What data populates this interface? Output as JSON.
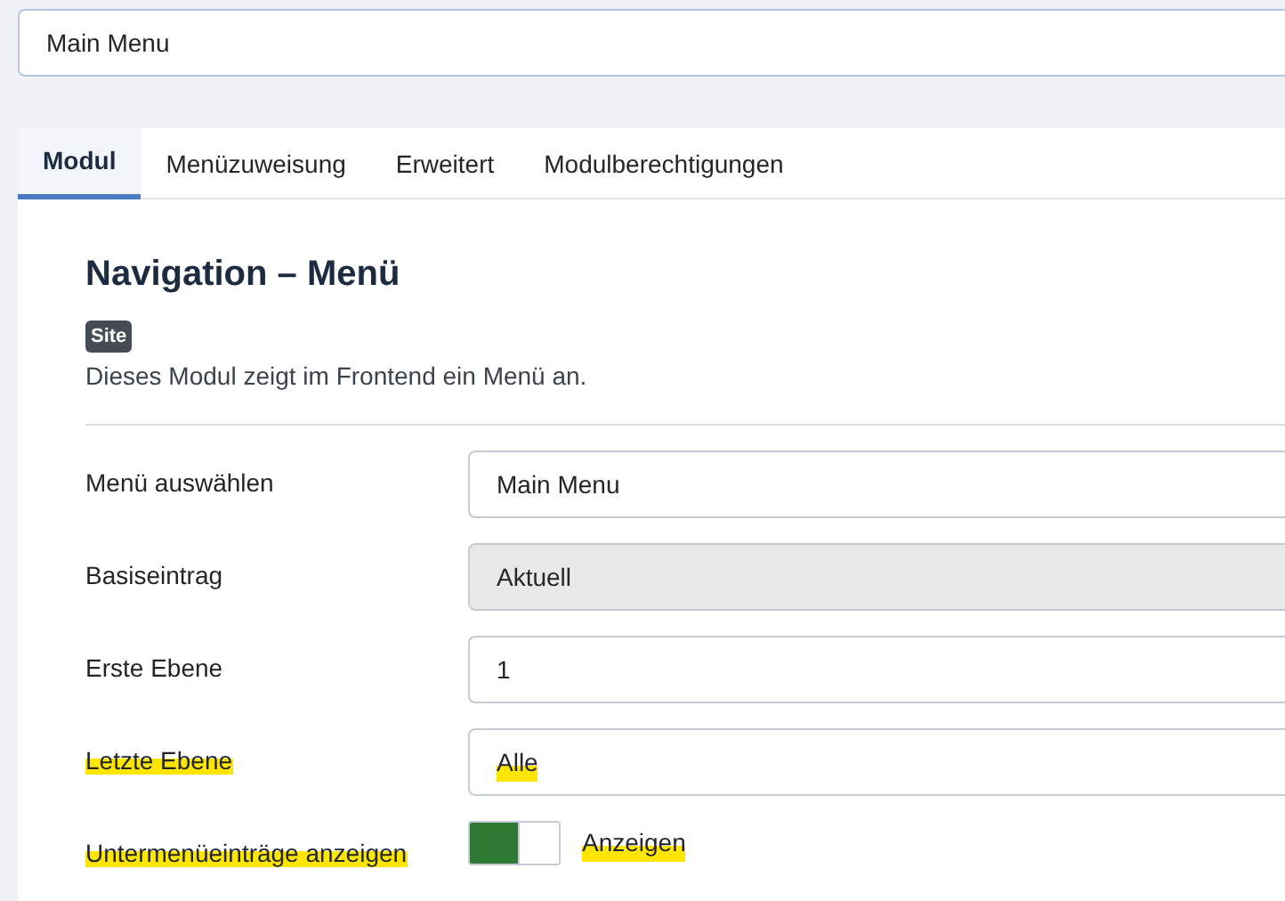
{
  "title_field": {
    "value": "Main Menu"
  },
  "tabs": [
    {
      "label": "Modul",
      "selected": true
    },
    {
      "label": "Menüzuweisung",
      "selected": false
    },
    {
      "label": "Erweitert",
      "selected": false
    },
    {
      "label": "Modulberechtigungen",
      "selected": false
    }
  ],
  "heading": "Navigation – Menü",
  "badge": "Site",
  "description": "Dieses Modul zeigt im Frontend ein Menü an.",
  "fields": [
    {
      "kind": "select",
      "label": "Menü auswählen",
      "value": "Main Menu",
      "disabled": false,
      "highlighted": false
    },
    {
      "kind": "select",
      "label": "Basiseintrag",
      "value": "Aktuell",
      "disabled": true,
      "highlighted": false
    },
    {
      "kind": "select",
      "label": "Erste Ebene",
      "value": "1",
      "disabled": false,
      "highlighted": false
    },
    {
      "kind": "select",
      "label": "Letzte Ebene",
      "value": "Alle",
      "disabled": false,
      "highlighted": true
    },
    {
      "kind": "switch",
      "label": "Untermenüeinträge anzeigen",
      "value": "Anzeigen",
      "on": true,
      "highlighted": true
    }
  ]
}
